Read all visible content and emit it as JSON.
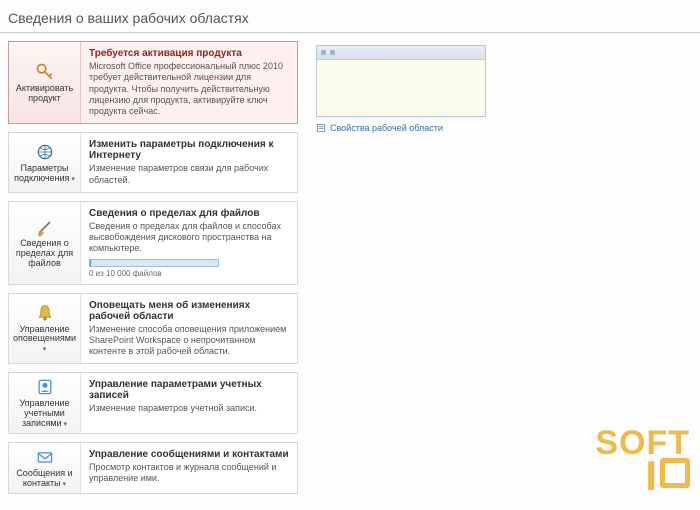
{
  "title": "Сведения о ваших рабочих областях",
  "cards": [
    {
      "btn": "Активировать продукт",
      "title": "Требуется активация продукта",
      "desc": "Microsoft Office профессиональный плюс 2010 требует действительной лицензии для продукта. Чтобы получить действительную лицензию для продукта, активируйте ключ продукта сейчас."
    },
    {
      "btn": "Параметры подключения",
      "title": "Изменить параметры подключения к Интернету",
      "desc": "Изменение параметров связи для рабочих областей."
    },
    {
      "btn": "Сведения о пределах для файлов",
      "title": "Сведения о пределах для файлов",
      "desc": "Сведения о пределах для файлов и способах высвобождения дискового пространства на компьютере.",
      "progress": "0 из 10 000 файлов"
    },
    {
      "btn": "Управление оповещениями",
      "title": "Оповещать меня об изменениях рабочей области",
      "desc": "Изменение способа оповещения приложением SharePoint Workspace о непрочитанном контенте в этой рабочей области."
    },
    {
      "btn": "Управление учетными записями",
      "title": "Управление параметрами учетных записей",
      "desc": "Изменение параметров учетной записи."
    },
    {
      "btn": "Сообщения и контакты",
      "title": "Управление сообщениями и контактами",
      "desc": "Просмотр контактов и журнала сообщений и управление ими."
    }
  ],
  "preview": {
    "link": "Свойства рабочей области"
  },
  "watermark": {
    "line1": "SOFT",
    "line2": "I"
  }
}
